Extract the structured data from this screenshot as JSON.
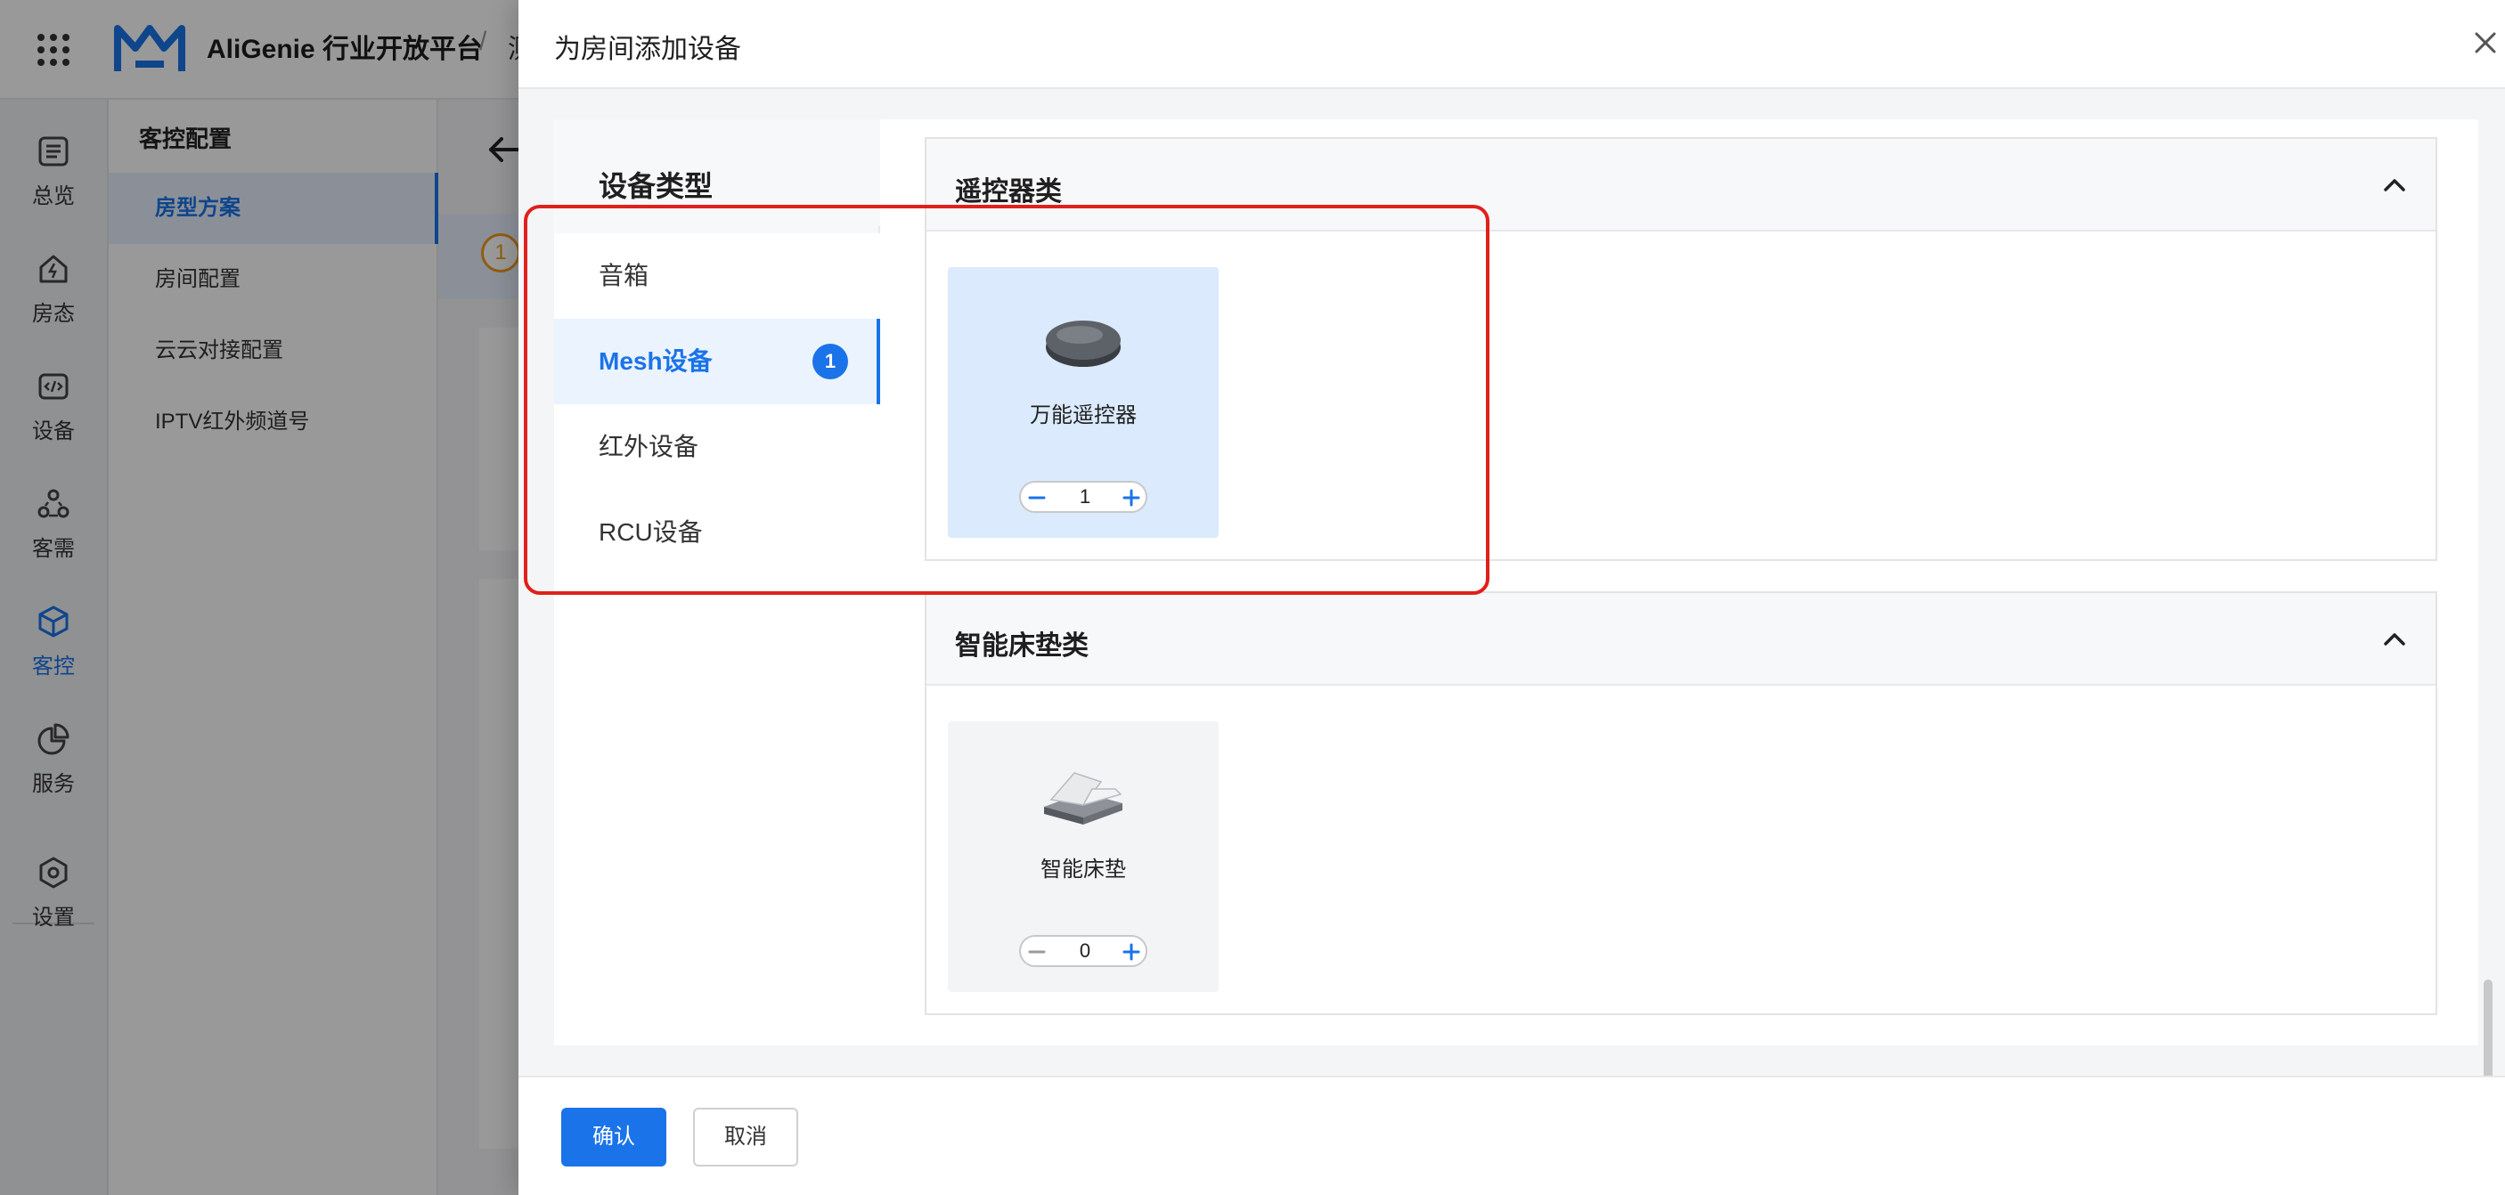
{
  "topbar": {
    "app_title": "AliGenie 行业开放平台",
    "crumb_separator": "/",
    "crumb_next": "测"
  },
  "left_nav": [
    {
      "label": "总览",
      "icon": "list-icon"
    },
    {
      "label": "房态",
      "icon": "house-icon"
    },
    {
      "label": "设备",
      "icon": "device-icon"
    },
    {
      "label": "客需",
      "icon": "people-icon"
    },
    {
      "label": "客控",
      "icon": "cube-icon",
      "active": true
    },
    {
      "label": "服务",
      "icon": "pie-chart-icon"
    },
    {
      "label": "设置",
      "icon": "gear-icon"
    }
  ],
  "sub_nav": {
    "title": "客控配置",
    "items": [
      {
        "label": "房型方案",
        "active": true
      },
      {
        "label": "房间配置"
      },
      {
        "label": "云云对接配置"
      },
      {
        "label": "IPTV红外频道号"
      }
    ]
  },
  "main": {
    "step_number": "1"
  },
  "drawer": {
    "title": "为房间添加设备",
    "type_title": "设备类型",
    "types": [
      {
        "label": "音箱"
      },
      {
        "label": "Mesh设备",
        "active": true,
        "badge": "1"
      },
      {
        "label": "红外设备"
      },
      {
        "label": "RCU设备"
      }
    ],
    "categories": [
      {
        "title": "遥控器类",
        "devices": [
          {
            "name": "万能遥控器",
            "quantity": "1",
            "selected": true
          }
        ]
      },
      {
        "title": "智能床垫类",
        "devices": [
          {
            "name": "智能床垫",
            "quantity": "0",
            "selected": false
          }
        ]
      }
    ],
    "footer": {
      "confirm_label": "确认",
      "cancel_label": "取消"
    }
  },
  "colors": {
    "accent": "#1a73e8",
    "highlight": "#e0201b",
    "step_badge": "#f29a1f"
  }
}
